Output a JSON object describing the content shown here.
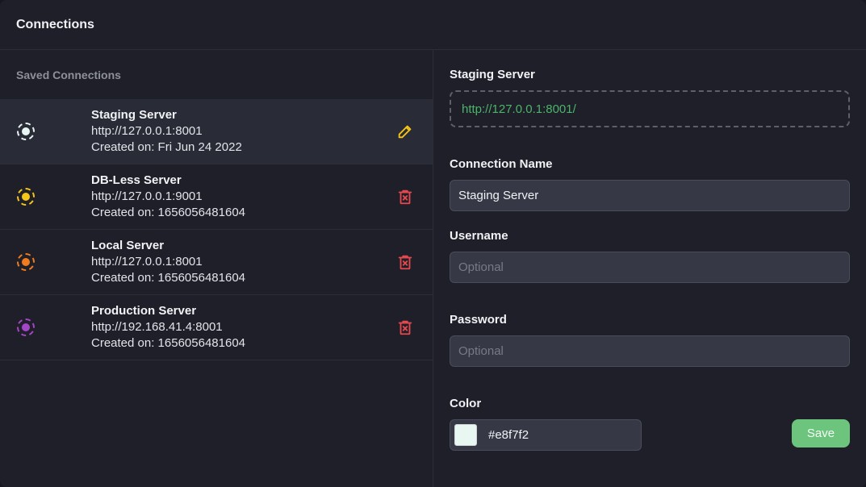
{
  "header": {
    "title": "Connections"
  },
  "sidebar": {
    "section_label": "Saved Connections",
    "connections": [
      {
        "name": "Staging Server",
        "url": "http://127.0.0.1:8001",
        "created": "Created on: Fri Jun 24 2022",
        "color": "#e8f7f2",
        "action": "edit-icon",
        "active": true
      },
      {
        "name": "DB-Less Server",
        "url": "http://127.0.0.1:9001",
        "created": "Created on: 1656056481604",
        "color": "#f5c518",
        "action": "trash-icon",
        "active": false
      },
      {
        "name": "Local Server",
        "url": "http://127.0.0.1:8001",
        "created": "Created on: 1656056481604",
        "color": "#f07c1e",
        "action": "trash-icon",
        "active": false
      },
      {
        "name": "Production Server",
        "url": "http://192.168.41.4:8001",
        "created": "Created on: 1656056481604",
        "color": "#a545c8",
        "action": "trash-icon",
        "active": false
      }
    ]
  },
  "form": {
    "heading": "Staging Server",
    "full_url": "http://127.0.0.1:8001/",
    "connection_name_label": "Connection Name",
    "connection_name_value": "Staging Server",
    "username_label": "Username",
    "username_placeholder": "Optional",
    "password_label": "Password",
    "password_placeholder": "Optional",
    "color_label": "Color",
    "color_value": "#e8f7f2",
    "save_label": "Save"
  },
  "colors": {
    "edit_icon": "#f5c518",
    "trash_icon": "#e5484d",
    "save_button": "#6cc47d",
    "url_text": "#4cb46a"
  }
}
